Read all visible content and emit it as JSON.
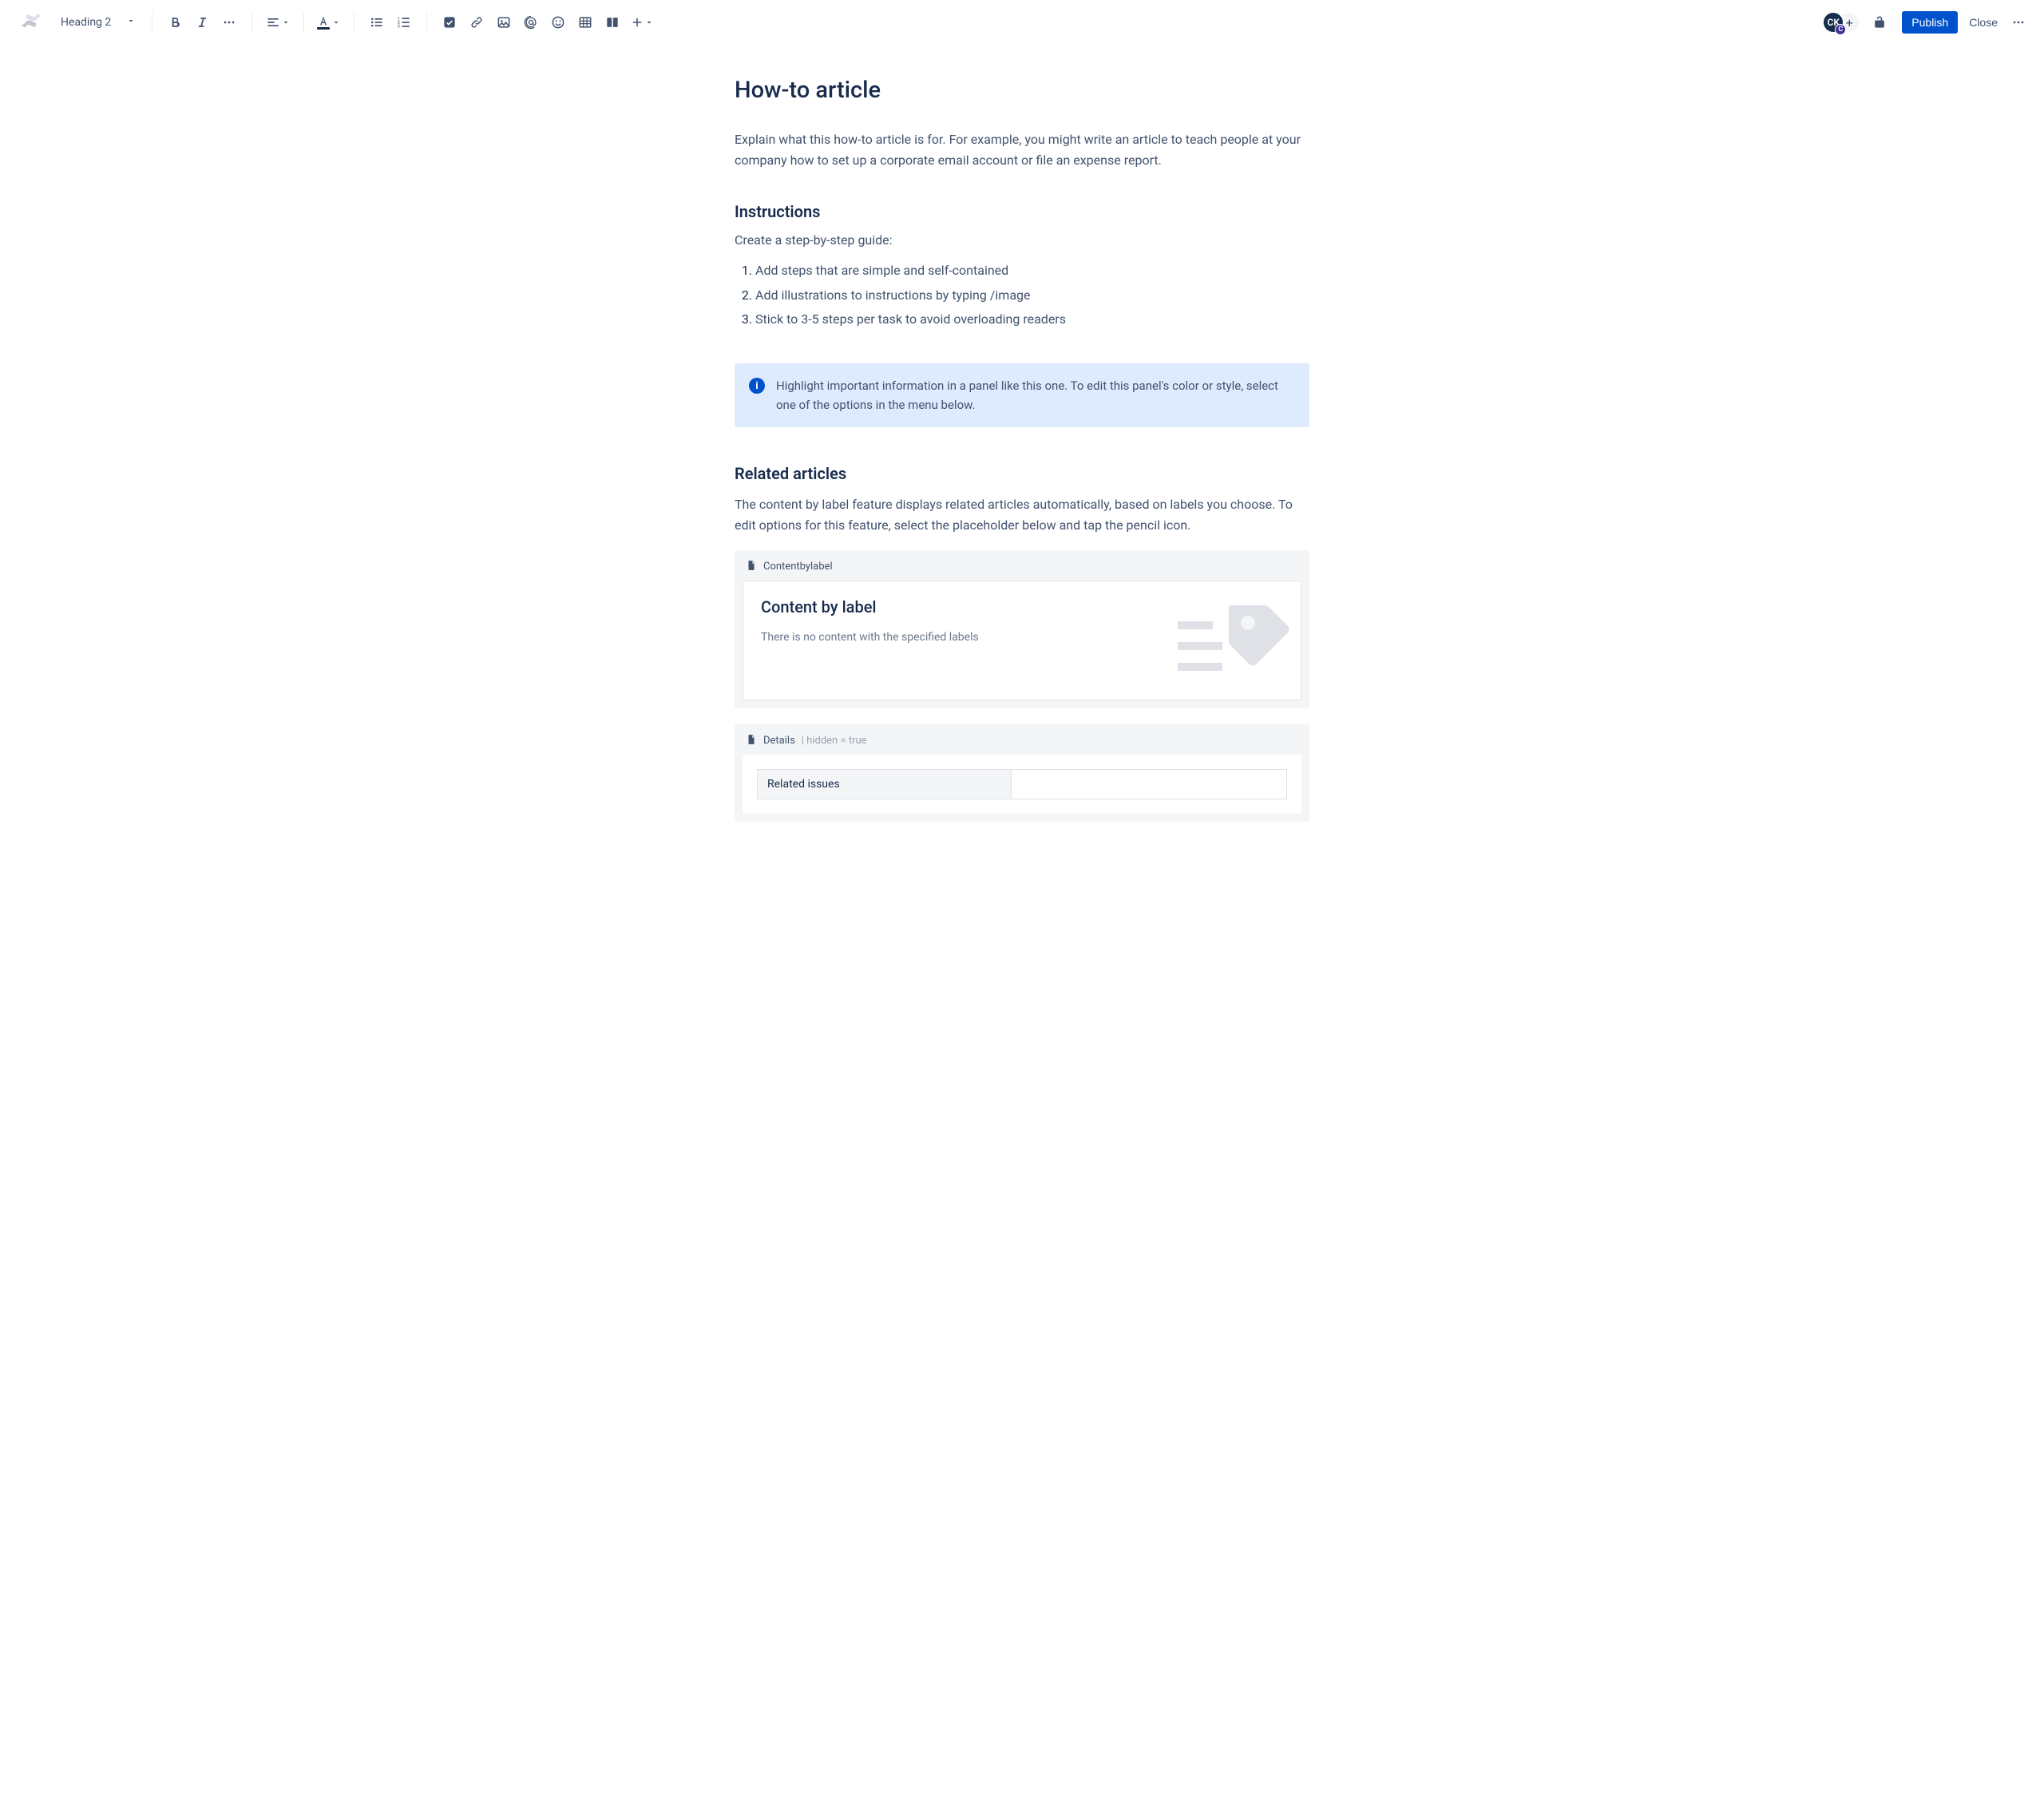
{
  "toolbar": {
    "text_style": "Heading 2",
    "publish_label": "Publish",
    "close_label": "Close",
    "avatar_initials": "CK",
    "avatar_sub": "C"
  },
  "page": {
    "title": "How-to article",
    "intro": "Explain what this how-to article is for. For example, you might write an article to teach people at your company how to set up a corporate email account or file an expense report.",
    "instructions_heading": "Instructions",
    "instructions_lead": "Create a step-by-step guide:",
    "steps": {
      "0": "Add steps that are simple and self-contained",
      "1": "Add illustrations to instructions by typing /image",
      "2": "Stick to 3-5 steps per task to avoid overloading readers"
    },
    "info_panel": "Highlight important information in a panel like this one. To edit this panel's color or style, select one of the options in the menu below.",
    "related_heading": "Related articles",
    "related_desc": "The content by label feature displays related articles automatically, based on labels you choose. To edit options for this feature, select the placeholder below and tap the pencil icon.",
    "macro_contentbylabel": {
      "header": "Contentbylabel",
      "card_title": "Content by label",
      "card_body": "There is no content with the specified labels"
    },
    "macro_details": {
      "header_label": "Details",
      "header_meta": " | hidden = true",
      "table_row_label": "Related issues",
      "table_row_value": ""
    }
  }
}
